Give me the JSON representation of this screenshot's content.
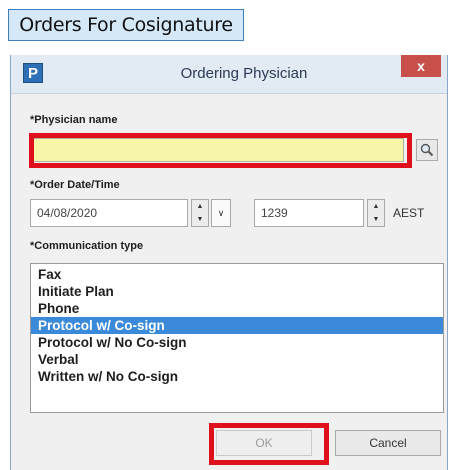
{
  "header": {
    "title": "Orders For Cosignature"
  },
  "dialog": {
    "app_icon": "P",
    "title": "Ordering Physician",
    "close_glyph": "x",
    "physician": {
      "label": "*Physician name",
      "value": "",
      "placeholder": ""
    },
    "order": {
      "label": "*Order Date/Time",
      "date": "04/08/2020",
      "time": "1239",
      "timezone": "AEST"
    },
    "communication": {
      "label": "*Communication type",
      "options": [
        "Fax",
        "Initiate Plan",
        "Phone",
        "Protocol w/ Co-sign",
        "Protocol w/ No Co-sign",
        "Verbal",
        "Written w/ No Co-sign"
      ],
      "selected": "Protocol w/ Co-sign"
    },
    "buttons": {
      "ok": "OK",
      "cancel": "Cancel"
    }
  },
  "colors": {
    "highlight_box": "#e0101a",
    "required_field": "#f7f5a8",
    "selection": "#3b8ad9"
  },
  "icons": [
    "search-icon",
    "close-icon",
    "spin-up-icon",
    "spin-down-icon",
    "chevron-down-icon"
  ]
}
